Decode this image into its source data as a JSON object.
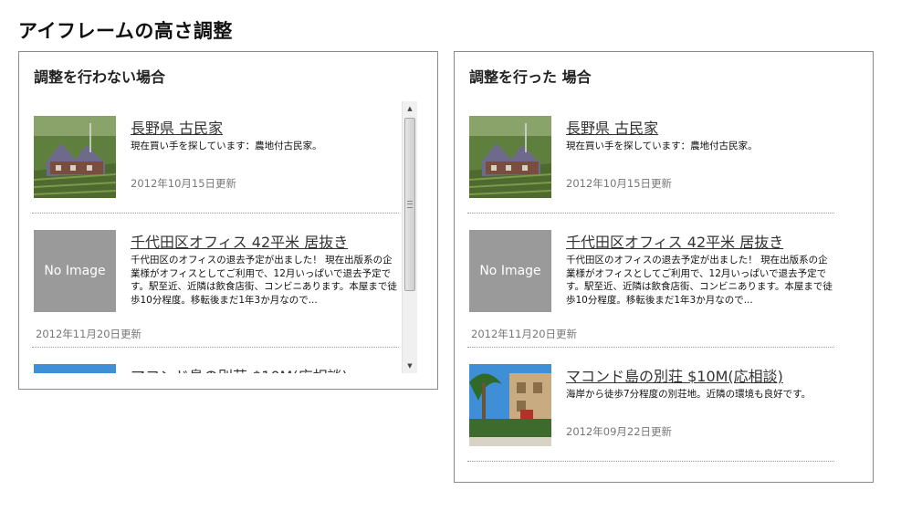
{
  "page": {
    "title": "アイフレームの高さ調整"
  },
  "panels": [
    {
      "heading": "調整を行わない場合"
    },
    {
      "heading": "調整を行った 場合"
    }
  ],
  "entries": [
    {
      "title": "長野県 古民家",
      "description": "現在買い手を探しています：農地付古民家。",
      "date": "2012年10月15日更新",
      "image": "farmhouse-photo"
    },
    {
      "title": "千代田区オフィス 42平米 居抜き",
      "description": "千代田区のオフィスの退去予定が出ました！ 現在出版系の企業様がオフィスとしてご利用で、12月いっぱいで退去予定です。駅至近、近隣は飲食店街、コンビニあります。本屋まで徒歩10分程度。移転後まだ1年3か月なので...",
      "date": "2012年11月20日更新",
      "image_label": "No Image"
    },
    {
      "title": "マコンド島の別荘 $10M(応相談)",
      "description": "海岸から徒歩7分程度の別荘地。近隣の環境も良好です。",
      "date": "2012年09月22日更新",
      "image": "villa-photo"
    }
  ],
  "scrollbar": {
    "up_icon": "triangle-up",
    "down_icon": "triangle-down"
  }
}
